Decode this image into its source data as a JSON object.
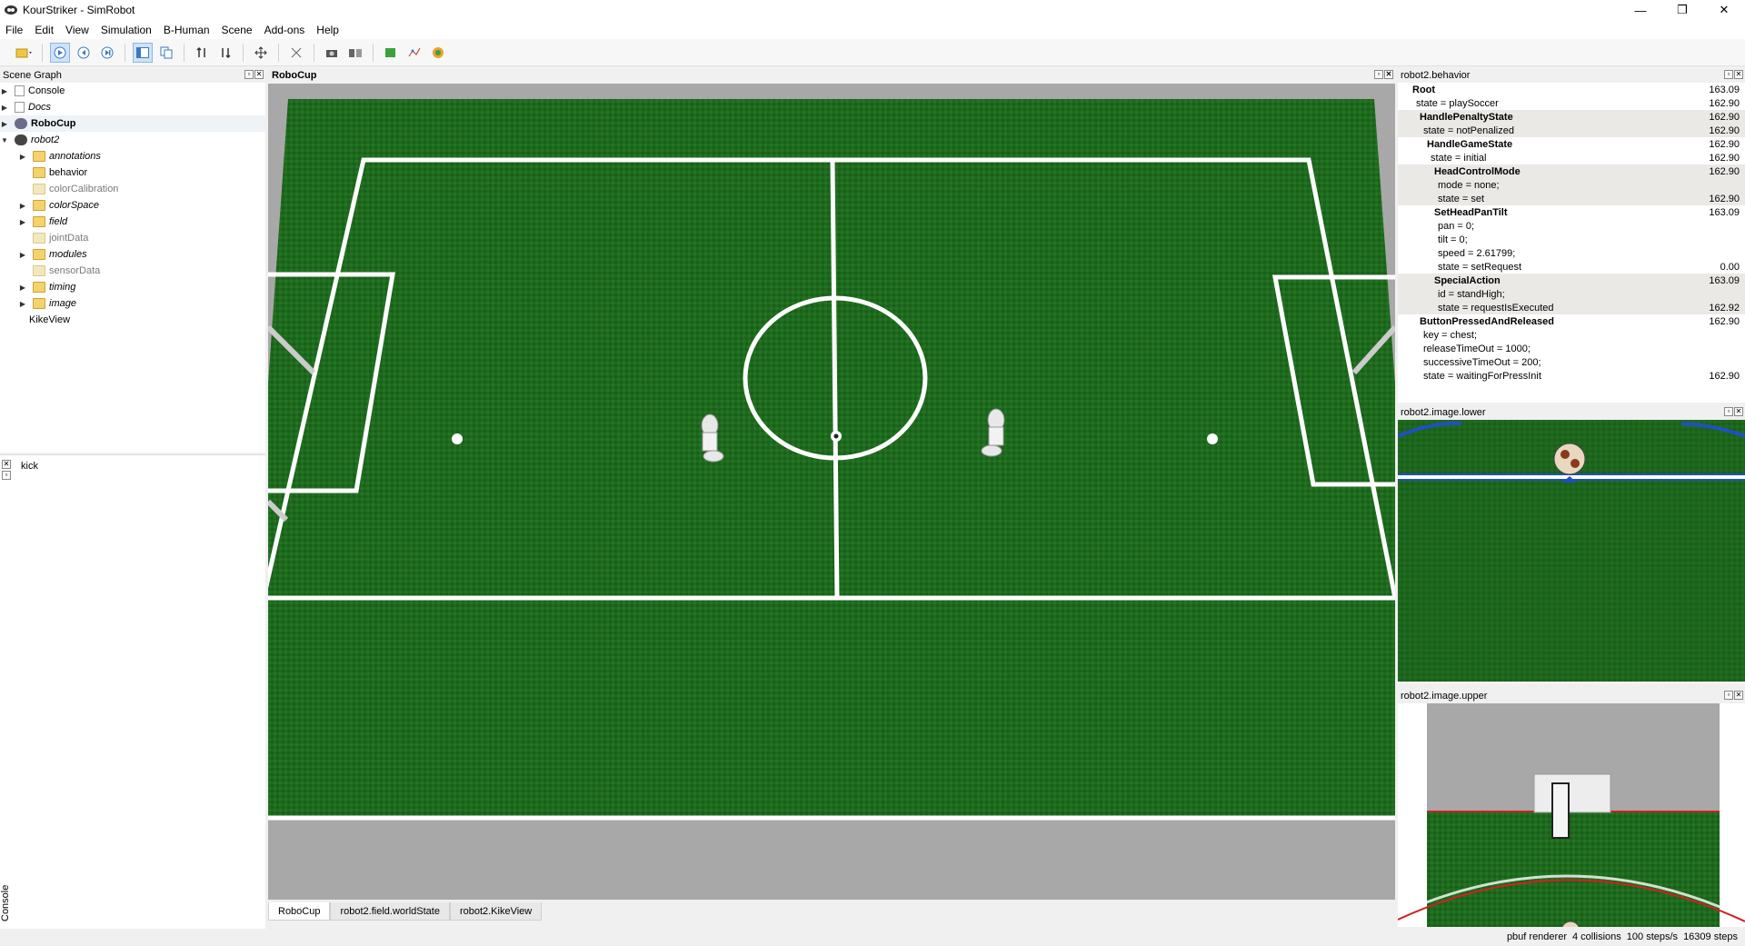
{
  "window": {
    "title": "KourStriker - SimRobot",
    "minimize": "—",
    "maximize": "❐",
    "close": "✕"
  },
  "menu": [
    "File",
    "Edit",
    "View",
    "Simulation",
    "B-Human",
    "Scene",
    "Add-ons",
    "Help"
  ],
  "scene_graph": {
    "title": "Scene Graph",
    "items": [
      {
        "label": "Console",
        "style": "normal"
      },
      {
        "label": "Docs",
        "style": "italic"
      },
      {
        "label": "RoboCup",
        "style": "bold"
      },
      {
        "label": "robot2",
        "style": "italic"
      },
      {
        "label": "annotations",
        "style": "italic"
      },
      {
        "label": "behavior",
        "style": "normal"
      },
      {
        "label": "colorCalibration",
        "style": "dim"
      },
      {
        "label": "colorSpace",
        "style": "italic"
      },
      {
        "label": "field",
        "style": "italic"
      },
      {
        "label": "jointData",
        "style": "dim"
      },
      {
        "label": "modules",
        "style": "italic"
      },
      {
        "label": "sensorData",
        "style": "dim"
      },
      {
        "label": "timing",
        "style": "italic"
      },
      {
        "label": "image",
        "style": "italic"
      },
      {
        "label": "KikeView",
        "style": "normal"
      }
    ]
  },
  "console": {
    "label": "Console",
    "text": "kick"
  },
  "robocup": {
    "title": "RoboCup",
    "tabs": [
      "RoboCup",
      "robot2.field.worldState",
      "robot2.KikeView"
    ]
  },
  "behavior": {
    "title": "robot2.behavior",
    "rows": [
      {
        "label": "Root",
        "value": "163.09"
      },
      {
        "label": "state = playSoccer",
        "value": "162.90"
      },
      {
        "label": "HandlePenaltyState",
        "value": "162.90"
      },
      {
        "label": "state = notPenalized",
        "value": "162.90"
      },
      {
        "label": "HandleGameState",
        "value": "162.90"
      },
      {
        "label": "state = initial",
        "value": "162.90"
      },
      {
        "label": "HeadControlMode",
        "value": "162.90"
      },
      {
        "label": "mode = none;",
        "value": ""
      },
      {
        "label": "state = set",
        "value": "162.90"
      },
      {
        "label": "SetHeadPanTilt",
        "value": "163.09"
      },
      {
        "label": "pan = 0;",
        "value": ""
      },
      {
        "label": "tilt = 0;",
        "value": ""
      },
      {
        "label": "speed = 2.61799;",
        "value": ""
      },
      {
        "label": "state = setRequest",
        "value": "0.00"
      },
      {
        "label": "SpecialAction",
        "value": "163.09"
      },
      {
        "label": "id = standHigh;",
        "value": ""
      },
      {
        "label": "state = requestIsExecuted",
        "value": "162.92"
      },
      {
        "label": "ButtonPressedAndReleased",
        "value": "162.90"
      },
      {
        "label": "key = chest;",
        "value": ""
      },
      {
        "label": "releaseTimeOut = 1000;",
        "value": ""
      },
      {
        "label": "successiveTimeOut = 200;",
        "value": ""
      },
      {
        "label": "state = waitingForPressInit",
        "value": "162.90"
      }
    ]
  },
  "image_lower": {
    "title": "robot2.image.lower"
  },
  "image_upper": {
    "title": "robot2.image.upper"
  },
  "status": {
    "renderer": "pbuf renderer",
    "collisions": "4 collisions",
    "steps_rate": "100 steps/s",
    "steps": "16309 steps"
  },
  "colors": {
    "field": "#1f6a1f",
    "line": "#ffffff",
    "background": "#a8a8a8",
    "highlight": "#ebe9e6"
  }
}
